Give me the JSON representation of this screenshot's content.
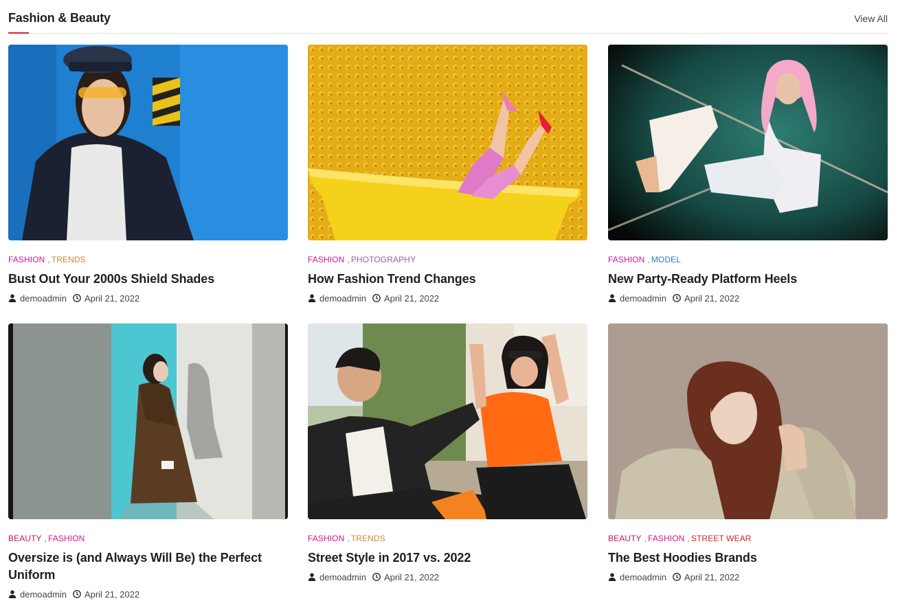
{
  "section": {
    "title": "Fashion & Beauty",
    "view_all": "View All"
  },
  "colors": {
    "accent": "#d21f2b",
    "fashion": "#d3138f",
    "trends": "#c98a33",
    "photography": "#9b59b6",
    "model": "#2e7bb5",
    "beauty": "#c2185b",
    "street_wear": "#d21f2b"
  },
  "posts": [
    {
      "categories": [
        {
          "label": "Fashion",
          "color": "#d3138f"
        },
        {
          "label": "Trends",
          "color": "#c98a33"
        }
      ],
      "title": "Bust Out Your 2000s Shield Shades",
      "author": "demoadmin",
      "date": "April 21, 2022",
      "image": "woman-blue-wall-photo"
    },
    {
      "categories": [
        {
          "label": "Fashion",
          "color": "#d3138f"
        },
        {
          "label": "Photography",
          "color": "#9b59b6"
        }
      ],
      "title": "How Fashion Trend Changes",
      "author": "demoadmin",
      "date": "April 21, 2022",
      "image": "yellow-bathtub-photo"
    },
    {
      "categories": [
        {
          "label": "Fashion",
          "color": "#d3138f"
        },
        {
          "label": "Model",
          "color": "#2e7bb5"
        }
      ],
      "title": "New Party-Ready Platform Heels",
      "author": "demoadmin",
      "date": "April 21, 2022",
      "image": "pink-hair-heels-photo"
    },
    {
      "categories": [
        {
          "label": "Beauty",
          "color": "#c2185b"
        },
        {
          "label": "Fashion",
          "color": "#d3138f"
        }
      ],
      "title": "Oversize is (and Always Will Be) the Perfect Uniform",
      "author": "demoadmin",
      "date": "April 21, 2022",
      "image": "oversize-coat-photo"
    },
    {
      "categories": [
        {
          "label": "Fashion",
          "color": "#d3138f"
        },
        {
          "label": "Trends",
          "color": "#c98a33"
        }
      ],
      "title": "Street Style in 2017 vs. 2022",
      "author": "demoadmin",
      "date": "April 21, 2022",
      "image": "street-style-couple-photo"
    },
    {
      "categories": [
        {
          "label": "Beauty",
          "color": "#c2185b"
        },
        {
          "label": "Fashion",
          "color": "#d3138f"
        },
        {
          "label": "Street Wear",
          "color": "#d21f2b"
        }
      ],
      "title": "The Best Hoodies Brands",
      "author": "demoadmin",
      "date": "April 21, 2022",
      "image": "hoodie-woman-photo"
    }
  ]
}
